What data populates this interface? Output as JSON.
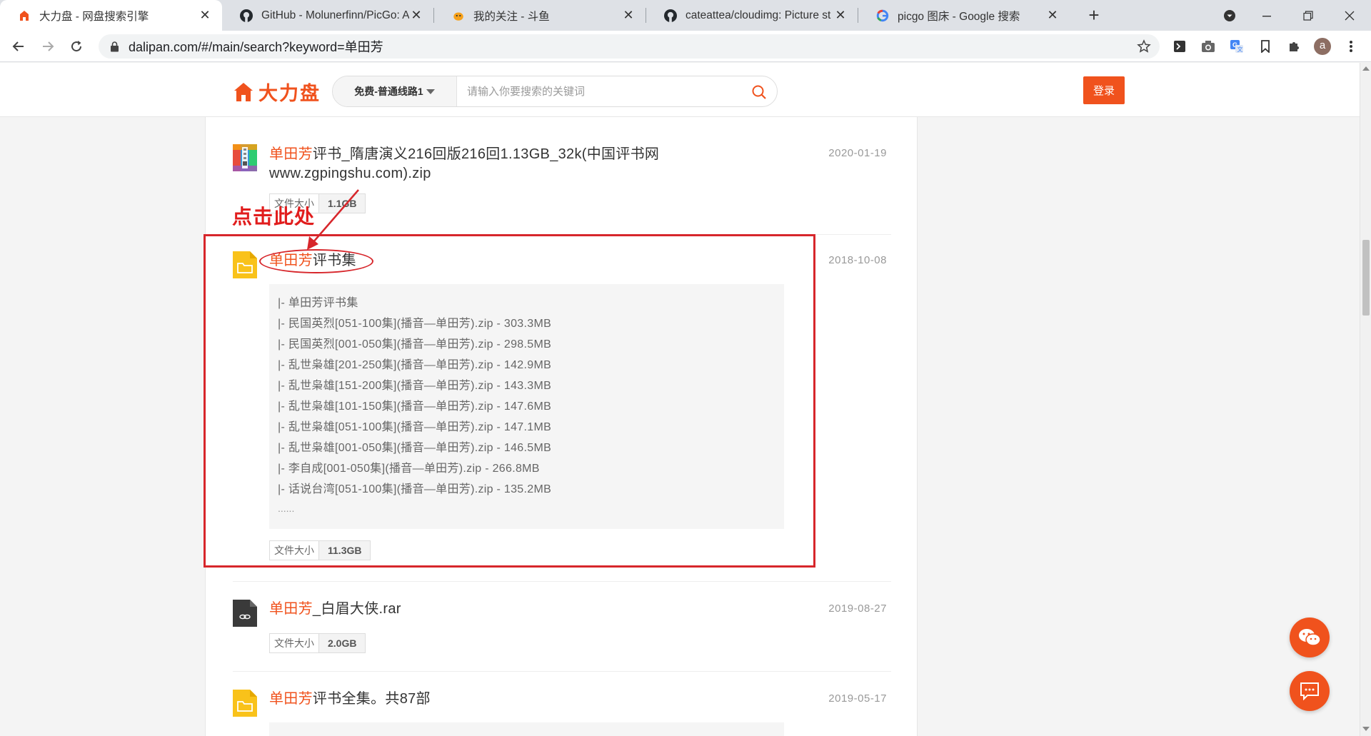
{
  "browser": {
    "tabs": [
      {
        "title": "大力盘 - 网盘搜索引擎",
        "favicon": "dalipan-icon"
      },
      {
        "title": "GitHub - Molunerfinn/PicGo: A",
        "favicon": "github-icon"
      },
      {
        "title": "我的关注 - 斗鱼",
        "favicon": "douyu-icon"
      },
      {
        "title": "cateattea/cloudimg: Picture st",
        "favicon": "github-icon"
      },
      {
        "title": "picgo 图床 - Google 搜索",
        "favicon": "google-icon"
      }
    ],
    "url": "dalipan.com/#/main/search?keyword=单田芳",
    "profile_initial": "a"
  },
  "header": {
    "logo_text": "大力盘",
    "route_label": "免费-普通线路1",
    "search_placeholder": "请输入你要搜索的关键词",
    "login_label": "登录"
  },
  "results": [
    {
      "keyword": "单田芳",
      "title_rest": "评书_隋唐演义216回版216回1.13GB_32k(中国评书网www.zgpingshu.com).zip",
      "date": "2020-01-19",
      "size_label": "文件大小",
      "size": "1.1GB",
      "icon": "zip-icon"
    },
    {
      "keyword": "单田芳",
      "title_rest": "评书集",
      "date": "2018-10-08",
      "size_label": "文件大小",
      "size": "11.3GB",
      "icon": "folder-icon",
      "files": [
        "|- 单田芳评书集",
        "|- 民国英烈[051-100集](播音—单田芳).zip - 303.3MB",
        "|- 民国英烈[001-050集](播音—单田芳).zip - 298.5MB",
        "|- 乱世枭雄[201-250集](播音—单田芳).zip - 142.9MB",
        "|- 乱世枭雄[151-200集](播音—单田芳).zip - 143.3MB",
        "|- 乱世枭雄[101-150集](播音—单田芳).zip - 147.6MB",
        "|- 乱世枭雄[051-100集](播音—单田芳).zip - 147.1MB",
        "|- 乱世枭雄[001-050集](播音—单田芳).zip - 146.5MB",
        "|- 李自成[001-050集](播音—单田芳).zip - 266.8MB",
        "|- 话说台湾[051-100集](播音—单田芳).zip - 135.2MB"
      ],
      "more": "......"
    },
    {
      "keyword": "单田芳",
      "title_rest": "_白眉大侠.rar",
      "date": "2019-08-27",
      "size_label": "文件大小",
      "size": "2.0GB",
      "icon": "rar-file-icon"
    },
    {
      "keyword": "单田芳",
      "title_rest": "评书全集。共87部",
      "date": "2019-05-17",
      "icon": "folder-icon"
    }
  ],
  "annotation": {
    "text": "点击此处",
    "color": "#d7262b"
  },
  "colors": {
    "brand": "#f0521d",
    "annotation_red": "#d7262b"
  }
}
